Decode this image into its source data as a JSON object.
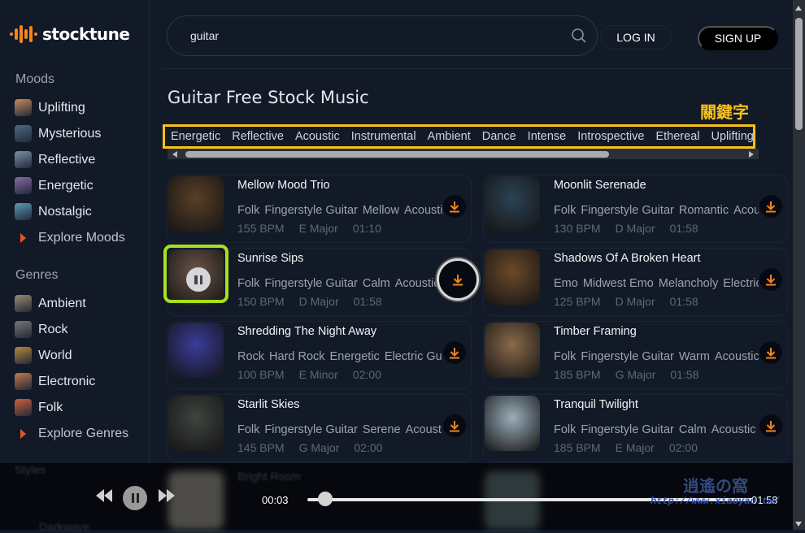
{
  "brand": {
    "name": "stocktune",
    "accent": "#f5841f"
  },
  "sidebar": {
    "moods_title": "Moods",
    "moods": [
      {
        "label": "Uplifting",
        "color": "#c98a5a"
      },
      {
        "label": "Mysterious",
        "color": "#4d6a82"
      },
      {
        "label": "Reflective",
        "color": "#7d8fa6"
      },
      {
        "label": "Energetic",
        "color": "#8a6aa8"
      },
      {
        "label": "Nostalgic",
        "color": "#5a9ab3"
      }
    ],
    "explore_moods": "Explore Moods",
    "genres_title": "Genres",
    "genres": [
      {
        "label": "Ambient",
        "color": "#9a8a72"
      },
      {
        "label": "Rock",
        "color": "#777"
      },
      {
        "label": "World",
        "color": "#b48a3a"
      },
      {
        "label": "Electronic",
        "color": "#c07a4a"
      },
      {
        "label": "Folk",
        "color": "#d0603a"
      }
    ],
    "explore_genres": "Explore Genres",
    "styles_title": "Styles"
  },
  "header": {
    "search_value": "guitar",
    "login": "LOG IN",
    "signup": "SIGN UP"
  },
  "main": {
    "title": "Guitar Free Stock Music",
    "keyword_annotation": "關鍵字",
    "keywords": [
      "Energetic",
      "Reflective",
      "Acoustic",
      "Instrumental",
      "Ambient",
      "Dance",
      "Intense",
      "Introspective",
      "Ethereal",
      "Uplifting"
    ],
    "tracks": [
      {
        "title": "Mellow Mood Trio",
        "tags": [
          "Folk",
          "Fingerstyle Guitar",
          "Mellow",
          "Acoustic"
        ],
        "bpm": "155 BPM",
        "key": "E Major",
        "duration": "01:10",
        "thumb": "#5a3f26"
      },
      {
        "title": "Moonlit Serenade",
        "tags": [
          "Folk",
          "Fingerstyle Guitar",
          "Romantic",
          "Acoustic"
        ],
        "bpm": "130 BPM",
        "key": "D Major",
        "duration": "01:58",
        "thumb": "#2c4254"
      },
      {
        "title": "Sunrise Sips",
        "tags": [
          "Folk",
          "Fingerstyle Guitar",
          "Calm",
          "Acoustic"
        ],
        "bpm": "150 BPM",
        "key": "D Major",
        "duration": "01:58",
        "thumb": "#6b5548",
        "playing": true
      },
      {
        "title": "Shadows Of A Broken Heart",
        "tags": [
          "Emo",
          "Midwest Emo",
          "Melancholy",
          "Electric"
        ],
        "bpm": "125 BPM",
        "key": "D Major",
        "duration": "01:58",
        "thumb": "#6a4a2a"
      },
      {
        "title": "Shredding The Night Away",
        "tags": [
          "Rock",
          "Hard Rock",
          "Energetic",
          "Electric Guitar"
        ],
        "bpm": "100 BPM",
        "key": "E Minor",
        "duration": "02:00",
        "thumb": "#3a3c9a"
      },
      {
        "title": "Timber Framing",
        "tags": [
          "Folk",
          "Fingerstyle Guitar",
          "Warm",
          "Acoustic"
        ],
        "bpm": "185 BPM",
        "key": "G Major",
        "duration": "01:58",
        "thumb": "#8a6a4a"
      },
      {
        "title": "Starlit Skies",
        "tags": [
          "Folk",
          "Fingerstyle Guitar",
          "Serene",
          "Acoustic"
        ],
        "bpm": "145 BPM",
        "key": "G Major",
        "duration": "02:00",
        "thumb": "#3f4540"
      },
      {
        "title": "Tranquil Twilight",
        "tags": [
          "Folk",
          "Fingerstyle Guitar",
          "Calm",
          "Acoustic"
        ],
        "bpm": "185 BPM",
        "key": "E Major",
        "duration": "02:00",
        "thumb": "#9aaebb"
      }
    ]
  },
  "player": {
    "current_time": "00:03",
    "total_time": "01:58",
    "progress": 0.025,
    "ghost_title": "Bright Room",
    "ghost_style": "Darkwave"
  },
  "watermark": {
    "text": "http://www.xiaoyao.tw/",
    "logo": "逍遙の窩"
  }
}
